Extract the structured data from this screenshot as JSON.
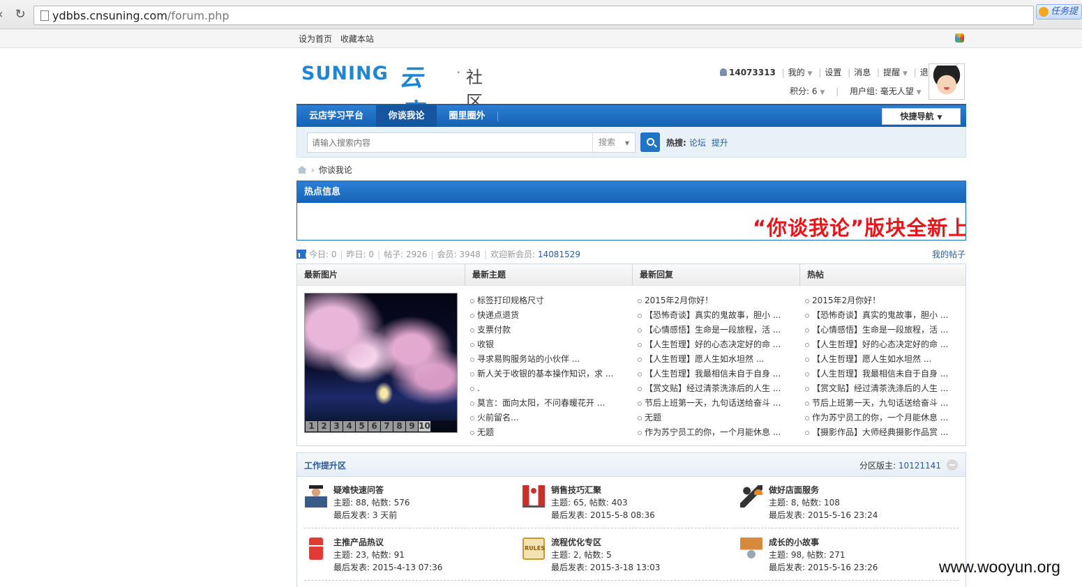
{
  "browser": {
    "url_domain": "ydbbs.cnsuning.com",
    "url_path": "/forum.php",
    "task_badge": "任务提"
  },
  "topbar": {
    "set_home": "设为首页",
    "bookmark": "收藏本站"
  },
  "header": {
    "logo_text": "SUNING",
    "logo_cn": "云店",
    "logo_sep": "·",
    "logo_sub": "社区",
    "user_id": "14073313",
    "menu": [
      "我的",
      "设置",
      "消息",
      "提醒",
      "退出"
    ],
    "points_label": "积分: 6",
    "usergroup_label": "用户组: 毫无人望"
  },
  "nav": {
    "items": [
      "云店学习平台",
      "你谈我论",
      "圈里圈外"
    ],
    "active_index": 1,
    "quick_nav": "快捷导航"
  },
  "search": {
    "placeholder": "请输入搜索内容",
    "type": "搜索",
    "hot_label": "热搜:",
    "hot_terms": [
      "论坛",
      "提升"
    ]
  },
  "breadcrumb": {
    "current": "你谈我论"
  },
  "hotinfo": {
    "title": "热点信息",
    "marquee": "“你谈我论”版块全新上"
  },
  "stats": {
    "today": "今日: 0",
    "yesterday": "昨日: 0",
    "posts": "帖子: 2926",
    "members": "会员: 3948",
    "welcome_label": "欢迎新会员:",
    "welcome_user": "14081529",
    "my_posts": "我的帖子"
  },
  "panels": {
    "headers": [
      "最新图片",
      "最新主题",
      "最新回复",
      "热帖"
    ],
    "photo_pages": [
      "1",
      "2",
      "3",
      "4",
      "5",
      "6",
      "7",
      "8",
      "9",
      "10"
    ],
    "latest_topics": [
      "标签打印规格尺寸",
      "快递点退货",
      "支票付款",
      "收银",
      "寻求易购服务站的小伙伴 ...",
      "新人关于收银的基本操作知识，求 ...",
      ".",
      "莫言：面向太阳，不问春暖花开 ...",
      "火前留名...",
      "无题"
    ],
    "latest_replies": [
      "2015年2月你好！",
      "【恐怖奇谈】真实的鬼故事，胆小 ...",
      "【心情感悟】生命是一段旅程，活 ...",
      "【人生哲理】好的心态决定好的命 ...",
      "【人生哲理】愿人生如水坦然 ...",
      "【人生哲理】我最相信未自于自身 ...",
      "【赏文贴】经过清茶洗涤后的人生 ...",
      "节后上班第一天，九句话送给奋斗 ...",
      "无题",
      "作为苏宁员工的你，一个月能休息 ..."
    ],
    "hot_posts": [
      "2015年2月你好！",
      "【恐怖奇谈】真实的鬼故事，胆小 ...",
      "【心情感悟】生命是一段旅程，活 ...",
      "【人生哲理】好的心态决定好的命 ...",
      "【人生哲理】愿人生如水坦然 ...",
      "【人生哲理】我最相信未自于自身 ...",
      "【赏文贴】经过清茶洗涤后的人生 ...",
      "节后上班第一天，九句话送给奋斗 ...",
      "作为苏宁员工的你，一个月能休息 ...",
      "【摄影作品】大师经典摄影作品赏 ..."
    ]
  },
  "forum": {
    "title": "工作提升区",
    "moderator_label": "分区版主:",
    "moderator": "10121141",
    "boards": [
      {
        "icon": "student-icon",
        "name": "疑难快速问答",
        "counts": "主题: 88, 帖数: 576",
        "last": "最后发表: 3 天前"
      },
      {
        "icon": "sales-icon",
        "name": "销售技巧汇聚",
        "counts": "主题: 65, 帖数: 403",
        "last": "最后发表: 2015-5-8 08:36"
      },
      {
        "icon": "service-icon",
        "name": "做好店面服务",
        "counts": "主题: 8, 帖数: 108",
        "last": "最后发表: 2015-5-16 23:24"
      },
      {
        "icon": "fridge-icon",
        "name": "主推产品热议",
        "counts": "主题: 23, 帖数: 91",
        "last": "最后发表: 2015-4-13 07:36"
      },
      {
        "icon": "rules-icon",
        "name": "流程优化专区",
        "counts": "主题: 2, 帖数: 5",
        "last": "最后发表: 2015-3-18 13:03"
      },
      {
        "icon": "story-icon",
        "name": "成长的小故事",
        "counts": "主题: 98, 帖数: 271",
        "last": "最后发表: 2015-5-16 23:26"
      }
    ]
  },
  "watermark": "www.wooyun.org"
}
